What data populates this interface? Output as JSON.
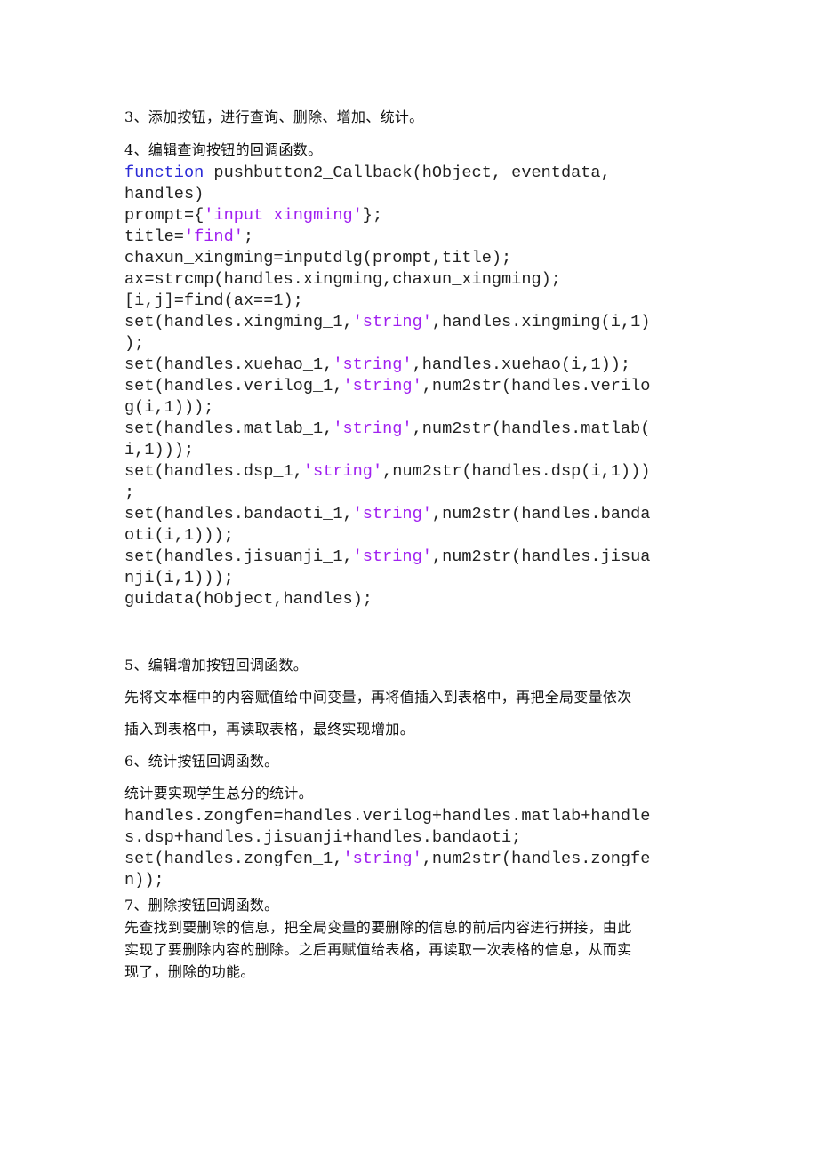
{
  "colors": {
    "keyword": "#2b2bd6",
    "string": "#a020f0",
    "text": "#222222"
  },
  "sections": {
    "step3": "3、添加按钮，进行查询、删除、增加、统计。",
    "step4": "4、编辑查询按钮的回调函数。",
    "step5": "5、编辑增加按钮回调函数。",
    "step5_desc_1": "先将文本框中的内容赋值给中间变量，再将值插入到表格中，再把全局变量依次",
    "step5_desc_2": "插入到表格中，再读取表格，最终实现增加。",
    "step6": "6、统计按钮回调函数。",
    "step6_desc": "统计要实现学生总分的统计。",
    "step7": "7、删除按钮回调函数。",
    "step7_desc_1": "先查找到要删除的信息，把全局变量的要删除的信息的前后内容进行拼接，由此",
    "step7_desc_2": "实现了要删除内容的删除。之后再赋值给表格，再读取一次表格的信息，从而实",
    "step7_desc_3": "现了，删除的功能。"
  },
  "code_find": [
    [
      {
        "t": "kw",
        "v": "function"
      },
      {
        "t": "p",
        "v": " pushbutton2_Callback(hObject, eventdata,"
      }
    ],
    [
      {
        "t": "p",
        "v": "handles)"
      }
    ],
    [
      {
        "t": "p",
        "v": "prompt={"
      },
      {
        "t": "str",
        "v": "'input xingming'"
      },
      {
        "t": "p",
        "v": "};"
      }
    ],
    [
      {
        "t": "p",
        "v": "title="
      },
      {
        "t": "str",
        "v": "'find'"
      },
      {
        "t": "p",
        "v": ";"
      }
    ],
    [
      {
        "t": "p",
        "v": "chaxun_xingming=inputdlg(prompt,title);"
      }
    ],
    [
      {
        "t": "p",
        "v": "ax=strcmp(handles.xingming,chaxun_xingming);"
      }
    ],
    [
      {
        "t": "p",
        "v": "[i,j]=find(ax==1);"
      }
    ],
    [
      {
        "t": "p",
        "v": "set(handles.xingming_1,"
      },
      {
        "t": "str",
        "v": "'string'"
      },
      {
        "t": "p",
        "v": ",handles.xingming(i,1)"
      }
    ],
    [
      {
        "t": "p",
        "v": ");"
      }
    ],
    [
      {
        "t": "p",
        "v": "set(handles.xuehao_1,"
      },
      {
        "t": "str",
        "v": "'string'"
      },
      {
        "t": "p",
        "v": ",handles.xuehao(i,1));"
      }
    ],
    [
      {
        "t": "p",
        "v": "set(handles.verilog_1,"
      },
      {
        "t": "str",
        "v": "'string'"
      },
      {
        "t": "p",
        "v": ",num2str(handles.verilo"
      }
    ],
    [
      {
        "t": "p",
        "v": "g(i,1)));"
      }
    ],
    [
      {
        "t": "p",
        "v": "set(handles.matlab_1,"
      },
      {
        "t": "str",
        "v": "'string'"
      },
      {
        "t": "p",
        "v": ",num2str(handles.matlab("
      }
    ],
    [
      {
        "t": "p",
        "v": "i,1)));"
      }
    ],
    [
      {
        "t": "p",
        "v": "set(handles.dsp_1,"
      },
      {
        "t": "str",
        "v": "'string'"
      },
      {
        "t": "p",
        "v": ",num2str(handles.dsp(i,1)))"
      }
    ],
    [
      {
        "t": "p",
        "v": ";"
      }
    ],
    [
      {
        "t": "p",
        "v": "set(handles.bandaoti_1,"
      },
      {
        "t": "str",
        "v": "'string'"
      },
      {
        "t": "p",
        "v": ",num2str(handles.banda"
      }
    ],
    [
      {
        "t": "p",
        "v": "oti(i,1)));"
      }
    ],
    [
      {
        "t": "p",
        "v": "set(handles.jisuanji_1,"
      },
      {
        "t": "str",
        "v": "'string'"
      },
      {
        "t": "p",
        "v": ",num2str(handles.jisua"
      }
    ],
    [
      {
        "t": "p",
        "v": "nji(i,1)));"
      }
    ],
    [
      {
        "t": "p",
        "v": "guidata(hObject,handles);"
      }
    ]
  ],
  "code_stat": [
    [
      {
        "t": "p",
        "v": "handles.zongfen=handles.verilog+handles.matlab+handle"
      }
    ],
    [
      {
        "t": "p",
        "v": "s.dsp+handles.jisuanji+handles.bandaoti;"
      }
    ],
    [
      {
        "t": "p",
        "v": "set(handles.zongfen_1,"
      },
      {
        "t": "str",
        "v": "'string'"
      },
      {
        "t": "p",
        "v": ",num2str(handles.zongfe"
      }
    ],
    [
      {
        "t": "p",
        "v": "n));"
      }
    ]
  ]
}
